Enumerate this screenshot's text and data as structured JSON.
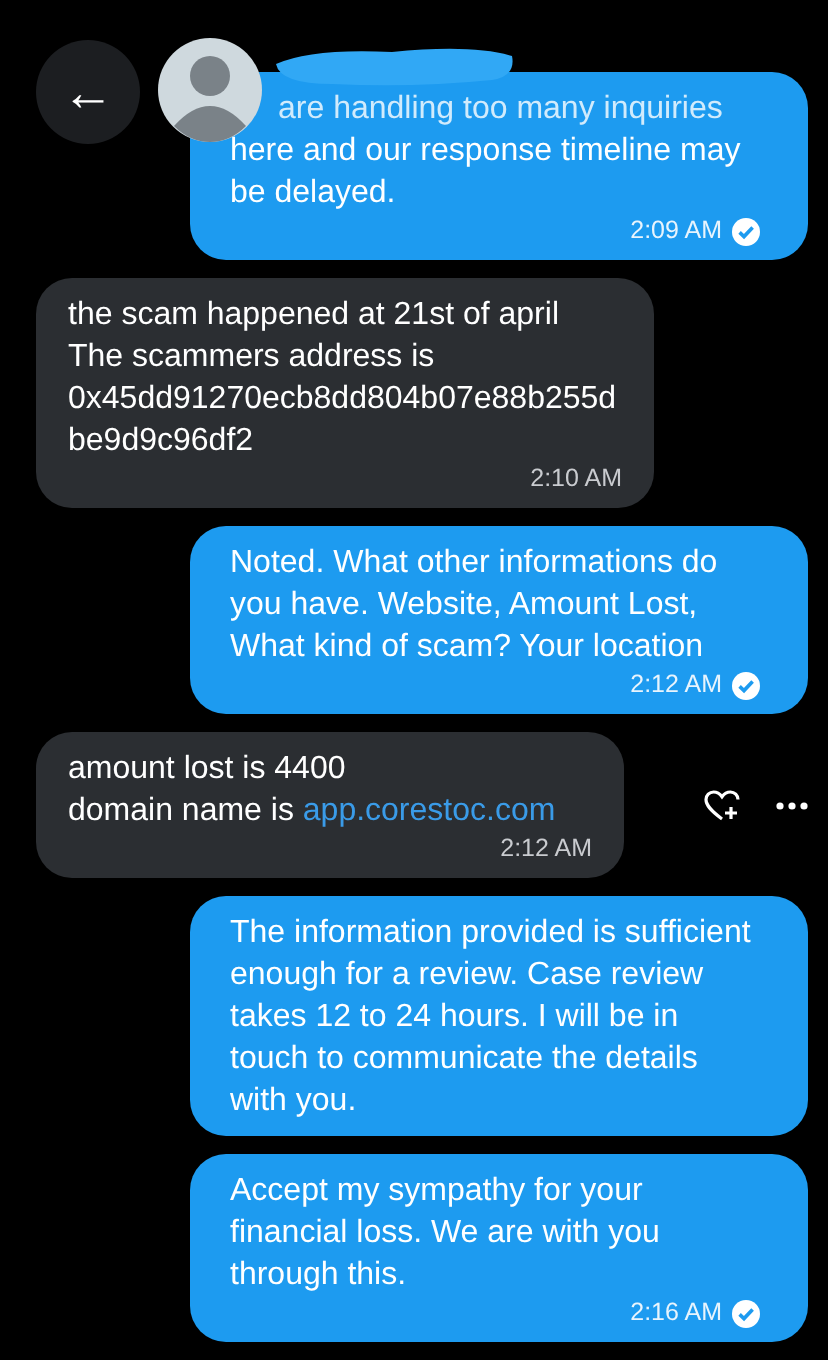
{
  "header": {
    "back": "←"
  },
  "messages": [
    {
      "kind": "sent",
      "faded_line": "are handling too many inquiries",
      "text": "here and our response timeline may be delayed.",
      "time": "2:09 AM",
      "read": true
    },
    {
      "kind": "received",
      "text": "the scam happened at 21st of april\nThe scammers address is\n0x45dd91270ecb8dd804b07e88b255dbe9d9c96df2",
      "time": "2:10 AM"
    },
    {
      "kind": "sent",
      "text": "Noted. What other informations do you have. Website, Amount Lost, What kind of scam? Your location",
      "time": "2:12 AM",
      "read": true
    },
    {
      "kind": "received",
      "text": "amount lost is 4400\ndomain name is ",
      "link": "app.corestoc.com",
      "time": "2:12 AM",
      "actions": true
    },
    {
      "kind": "sent",
      "text": "The information provided is sufficient enough for a review. Case review takes 12 to 24 hours. I will be in touch to communicate the details with you."
    },
    {
      "kind": "sent",
      "text": "Accept my sympathy for your financial loss. We are with you through this.",
      "time": "2:16 AM",
      "read": true
    }
  ]
}
